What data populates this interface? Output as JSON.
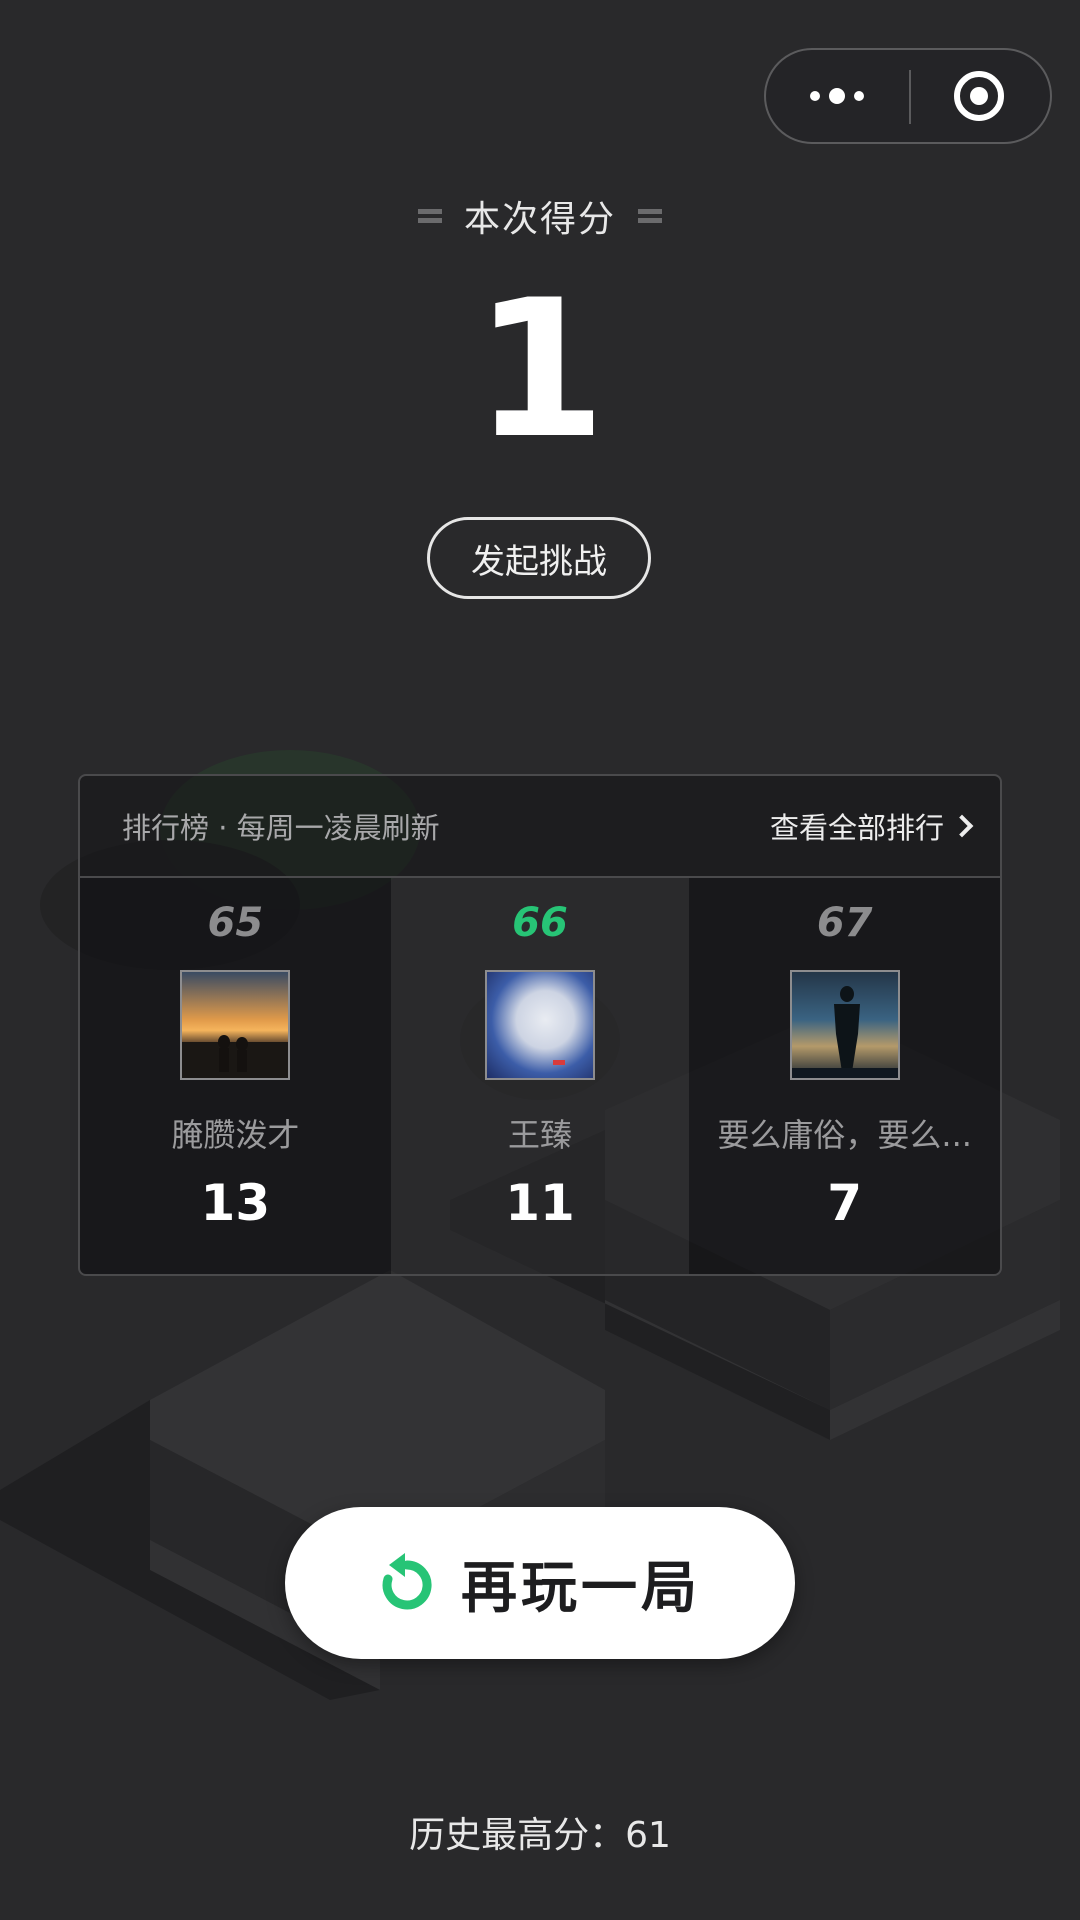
{
  "app": {
    "score_title": "本次得分",
    "score_value": "1",
    "challenge_label": "发起挑战",
    "best_label": "历史最高分：61"
  },
  "leaderboard": {
    "subtitle": "排行榜 · 每周一凌晨刷新",
    "view_all_label": "查看全部排行",
    "entries": [
      {
        "rank": "65",
        "name": "腌臜泼才",
        "score": "13",
        "is_me": false
      },
      {
        "rank": "66",
        "name": "王臻",
        "score": "11",
        "is_me": true
      },
      {
        "rank": "67",
        "name": "要么庸俗，要么...",
        "score": "7",
        "is_me": false
      }
    ]
  },
  "actions": {
    "replay_label": "再玩一局"
  },
  "colors": {
    "background": "#29292b",
    "accent_green": "#27c476",
    "text_light": "#e8e8e8"
  },
  "icons": [
    "more-icon",
    "target-icon",
    "chevron-right-icon",
    "replay-icon"
  ]
}
